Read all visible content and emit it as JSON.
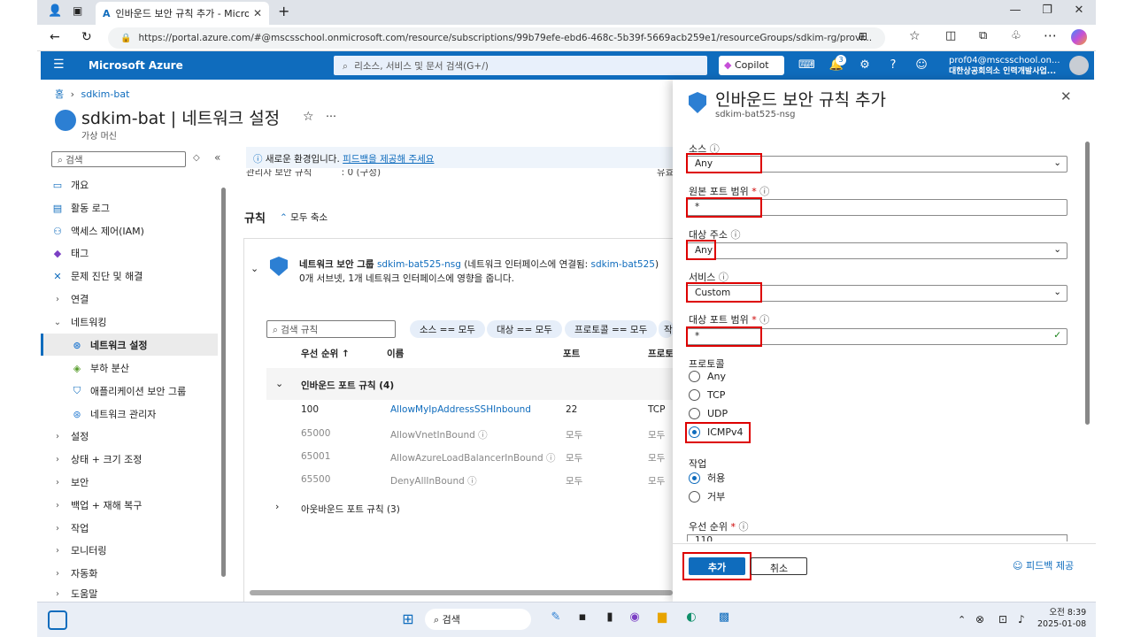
{
  "browser": {
    "tab_title": "인바운드 보안 규칙 추가 - Micros",
    "url": "https://portal.azure.com/#@mscsschool.onmicrosoft.com/resource/subscriptions/99b79efe-ebd6-468c-5b39f-5669acb259e1/resourceGroups/sdkim-rg/provi..."
  },
  "azure_header": {
    "brand": "Microsoft Azure",
    "search_placeholder": "리소스, 서비스 및 문서 검색(G+/)",
    "copilot": "Copilot",
    "notification_count": "3",
    "account_email": "prof04@mscsschool.on...",
    "account_org": "대한상공회의소 인력개발사업..."
  },
  "breadcrumb": {
    "home": "홈",
    "item": "sdkim-bat"
  },
  "page": {
    "title": "sdkim-bat | 네트워크 설정",
    "subtitle": "가상 머신",
    "search_placeholder": "검색"
  },
  "sidebar": {
    "items": [
      {
        "label": "개요"
      },
      {
        "label": "활동 로그"
      },
      {
        "label": "액세스 제어(IAM)"
      },
      {
        "label": "태그"
      },
      {
        "label": "문제 진단 및 해결"
      },
      {
        "label": "연결"
      },
      {
        "label": "네트워킹"
      },
      {
        "label": "네트워크 설정"
      },
      {
        "label": "부하 분산"
      },
      {
        "label": "애플리케이션 보안 그룹"
      },
      {
        "label": "네트워크 관리자"
      },
      {
        "label": "설정"
      },
      {
        "label": "상태 + 크기 조정"
      },
      {
        "label": "보안"
      },
      {
        "label": "백업 + 재해 복구"
      },
      {
        "label": "작업"
      },
      {
        "label": "모니터링"
      },
      {
        "label": "자동화"
      },
      {
        "label": "도움말"
      }
    ]
  },
  "main": {
    "banner_prefix": "새로운 환경입니다.",
    "banner_link": "피드백을 제공해 주세요",
    "cut_row": "관리자 보안 규칙",
    "cut_value": ": 0 (구성)",
    "cut_right": "유효",
    "rules_heading": "규칙",
    "collapse_all": "모두 축소",
    "nsg_label": "네트워크 보안 그룹",
    "nsg_name": "sdkim-bat525-nsg",
    "nsg_attached_prefix": "(네트워크 인터페이스에 연결됨:",
    "nsg_attached_target": "sdkim-bat525",
    "nsg_attached_suffix": ")",
    "nsg_desc": "0개 서브넷, 1개 네트워크 인터페이스에 영향을 줍니다.",
    "rule_search_placeholder": "검색 규칙",
    "filters": [
      "소스 == 모두",
      "대상 == 모두",
      "프로토콜 == 모두",
      "작"
    ],
    "columns": [
      "우선 순위 ↑",
      "이름",
      "포트",
      "프로토"
    ],
    "inbound_group": "인바운드 포트 규칙 (4)",
    "outbound_group": "아웃바운드 포트 규칙 (3)",
    "rules": [
      {
        "priority": "100",
        "name": "AllowMyIpAddressSSHInbound",
        "port": "22",
        "protocol": "TCP"
      },
      {
        "priority": "65000",
        "name": "AllowVnetInBound",
        "port": "모두",
        "protocol": "모두"
      },
      {
        "priority": "65001",
        "name": "AllowAzureLoadBalancerInBound",
        "port": "모두",
        "protocol": "모두"
      },
      {
        "priority": "65500",
        "name": "DenyAllInBound",
        "port": "모두",
        "protocol": "모두"
      }
    ]
  },
  "panel": {
    "title": "인바운드 보안 규칙 추가",
    "subtitle": "sdkim-bat525-nsg",
    "source_label": "소스",
    "source_value": "Any",
    "source_port_label": "원본 포트 범위",
    "source_port_value": "*",
    "dest_label": "대상 주소",
    "dest_value": "Any",
    "service_label": "서비스",
    "service_value": "Custom",
    "dest_port_label": "대상 포트 범위",
    "dest_port_value": "*",
    "protocol_label": "프로토콜",
    "protocol_options": [
      "Any",
      "TCP",
      "UDP",
      "ICMPv4"
    ],
    "protocol_selected": "ICMPv4",
    "action_label": "작업",
    "action_options": [
      "허용",
      "거부"
    ],
    "action_selected": "허용",
    "priority_label": "우선 순위",
    "priority_value": "110",
    "add_button": "추가",
    "cancel_button": "취소",
    "feedback": "피드백 제공",
    "required_mark": "*"
  },
  "taskbar": {
    "search": "검색",
    "time": "오전 8:39",
    "date": "2025-01-08"
  }
}
